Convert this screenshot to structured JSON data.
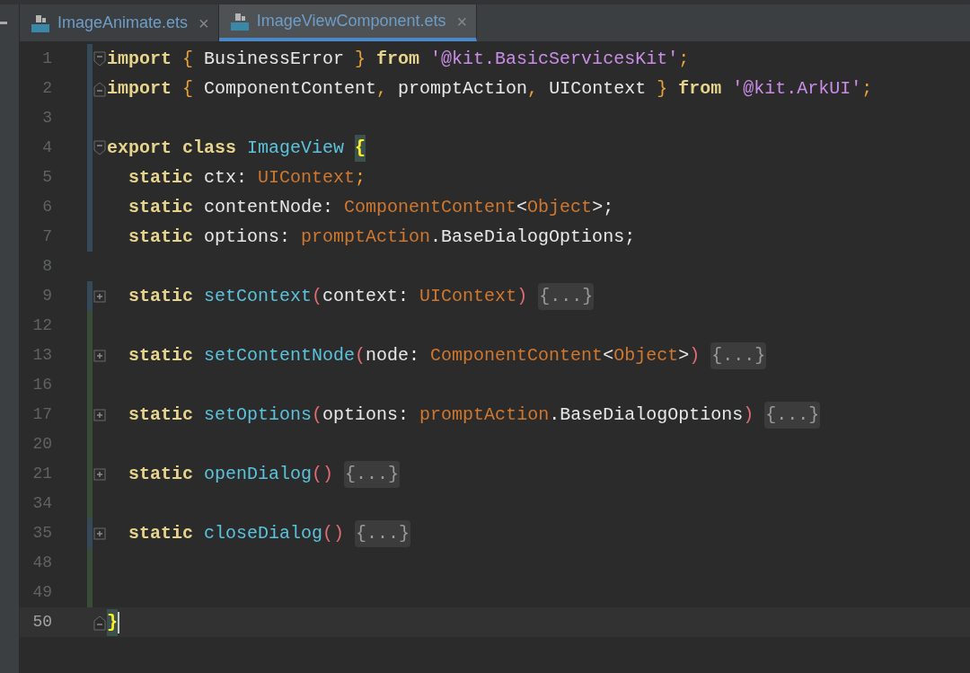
{
  "tabs": [
    {
      "label": "ImageAnimate.ets",
      "close": "×",
      "selected": false
    },
    {
      "label": "ImageViewComponent.ets",
      "close": "×",
      "selected": true
    }
  ],
  "lines": [
    {
      "number": "1",
      "modified": true,
      "added": false,
      "current": false,
      "gutter_icon": {
        "kind": "fold_start"
      },
      "tokens": [
        {
          "text": "import ",
          "kind": "keyword"
        },
        {
          "text": "{ ",
          "kind": "brace"
        },
        {
          "text": "BusinessError ",
          "kind": "plain"
        },
        {
          "text": "} ",
          "kind": "brace"
        },
        {
          "text": "from ",
          "kind": "keyword"
        },
        {
          "text": "'@kit.BasicServicesKit'",
          "kind": "string"
        },
        {
          "text": ";",
          "kind": "brace"
        }
      ]
    },
    {
      "number": "2",
      "modified": true,
      "added": false,
      "current": false,
      "gutter_icon": {
        "kind": "fold_end"
      },
      "tokens": [
        {
          "text": "import ",
          "kind": "keyword"
        },
        {
          "text": "{ ",
          "kind": "brace"
        },
        {
          "text": "ComponentContent",
          "kind": "plain"
        },
        {
          "text": ", ",
          "kind": "brace"
        },
        {
          "text": "promptAction",
          "kind": "plain"
        },
        {
          "text": ", ",
          "kind": "brace"
        },
        {
          "text": "UIContext ",
          "kind": "plain"
        },
        {
          "text": "} ",
          "kind": "brace"
        },
        {
          "text": "from ",
          "kind": "keyword"
        },
        {
          "text": "'@kit.ArkUI'",
          "kind": "string"
        },
        {
          "text": ";",
          "kind": "brace"
        }
      ]
    },
    {
      "number": "3",
      "modified": true,
      "added": false,
      "current": false
    },
    {
      "number": "4",
      "modified": true,
      "added": false,
      "current": false,
      "gutter_icon": {
        "kind": "fold_start"
      },
      "tokens": [
        {
          "text": "export class ",
          "kind": "keyword"
        },
        {
          "text": "ImageView ",
          "kind": "classname"
        },
        {
          "text": "{",
          "kind": "brace_match"
        }
      ]
    },
    {
      "number": "5",
      "modified": true,
      "added": false,
      "current": false,
      "tokens": [
        {
          "text": "  static ",
          "kind": "keyword"
        },
        {
          "text": "ctx: ",
          "kind": "plain"
        },
        {
          "text": "UIContext",
          "kind": "type"
        },
        {
          "text": ";",
          "kind": "brace"
        }
      ]
    },
    {
      "number": "6",
      "modified": true,
      "added": false,
      "current": false,
      "tokens": [
        {
          "text": "  static ",
          "kind": "keyword"
        },
        {
          "text": "contentNode: ",
          "kind": "plain"
        },
        {
          "text": "ComponentContent",
          "kind": "type"
        },
        {
          "text": "<",
          "kind": "plain"
        },
        {
          "text": "Object",
          "kind": "type"
        },
        {
          "text": ">;",
          "kind": "plain"
        }
      ]
    },
    {
      "number": "7",
      "modified": true,
      "added": false,
      "current": false,
      "tokens": [
        {
          "text": "  static ",
          "kind": "keyword"
        },
        {
          "text": "options: ",
          "kind": "plain"
        },
        {
          "text": "promptAction",
          "kind": "type"
        },
        {
          "text": ".BaseDialogOptions;",
          "kind": "plain"
        }
      ]
    },
    {
      "number": "8",
      "modified": false,
      "added": false,
      "current": false
    },
    {
      "number": "9",
      "modified": true,
      "added": false,
      "current": false,
      "gutter_icon": {
        "kind": "expand"
      },
      "tokens": [
        {
          "text": "  static ",
          "kind": "keyword"
        },
        {
          "text": "setContext",
          "kind": "method"
        },
        {
          "text": "(",
          "kind": "paren"
        },
        {
          "text": "context: ",
          "kind": "plain"
        },
        {
          "text": "UIContext",
          "kind": "type"
        },
        {
          "text": ") ",
          "kind": "paren"
        },
        {
          "text": "{...}",
          "kind": "folded"
        }
      ]
    },
    {
      "number": "12",
      "modified": false,
      "added": true,
      "current": false
    },
    {
      "number": "13",
      "modified": false,
      "added": true,
      "current": false,
      "gutter_icon": {
        "kind": "expand"
      },
      "tokens": [
        {
          "text": "  static ",
          "kind": "keyword"
        },
        {
          "text": "setContentNode",
          "kind": "method"
        },
        {
          "text": "(",
          "kind": "paren"
        },
        {
          "text": "node: ",
          "kind": "plain"
        },
        {
          "text": "ComponentContent",
          "kind": "type"
        },
        {
          "text": "<",
          "kind": "plain"
        },
        {
          "text": "Object",
          "kind": "type"
        },
        {
          "text": ">",
          "kind": "plain"
        },
        {
          "text": ") ",
          "kind": "paren"
        },
        {
          "text": "{...}",
          "kind": "folded"
        }
      ]
    },
    {
      "number": "16",
      "modified": false,
      "added": true,
      "current": false
    },
    {
      "number": "17",
      "modified": false,
      "added": true,
      "current": false,
      "gutter_icon": {
        "kind": "expand"
      },
      "tokens": [
        {
          "text": "  static ",
          "kind": "keyword"
        },
        {
          "text": "setOptions",
          "kind": "method"
        },
        {
          "text": "(",
          "kind": "paren"
        },
        {
          "text": "options: ",
          "kind": "plain"
        },
        {
          "text": "promptAction",
          "kind": "type"
        },
        {
          "text": ".BaseDialogOptions",
          "kind": "plain"
        },
        {
          "text": ") ",
          "kind": "paren"
        },
        {
          "text": "{...}",
          "kind": "folded"
        }
      ]
    },
    {
      "number": "20",
      "modified": false,
      "added": true,
      "current": false
    },
    {
      "number": "21",
      "modified": false,
      "added": true,
      "current": false,
      "gutter_icon": {
        "kind": "expand"
      },
      "tokens": [
        {
          "text": "  static ",
          "kind": "keyword"
        },
        {
          "text": "openDialog",
          "kind": "method"
        },
        {
          "text": "() ",
          "kind": "paren"
        },
        {
          "text": "{...}",
          "kind": "folded"
        }
      ]
    },
    {
      "number": "34",
      "modified": false,
      "added": true,
      "current": false
    },
    {
      "number": "35",
      "modified": true,
      "added": false,
      "current": false,
      "gutter_icon": {
        "kind": "expand"
      },
      "tokens": [
        {
          "text": "  static ",
          "kind": "keyword"
        },
        {
          "text": "closeDialog",
          "kind": "method"
        },
        {
          "text": "() ",
          "kind": "paren"
        },
        {
          "text": "{...}",
          "kind": "folded"
        }
      ]
    },
    {
      "number": "48",
      "modified": false,
      "added": true,
      "current": false
    },
    {
      "number": "49",
      "modified": false,
      "added": true,
      "current": false
    },
    {
      "number": "50",
      "modified": false,
      "added": false,
      "current": true,
      "gutter_icon": {
        "kind": "fold_end"
      },
      "tokens": [
        {
          "text": "}",
          "kind": "brace_match"
        }
      ]
    }
  ]
}
